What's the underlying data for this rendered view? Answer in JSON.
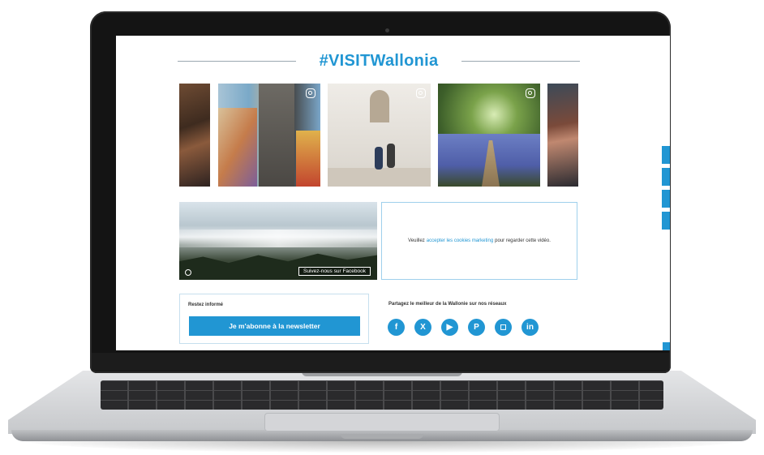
{
  "page": {
    "hashtag": "#VISITWallonia",
    "colors": {
      "accent": "#2196d3",
      "divider": "#9aa7b1",
      "border": "#9fd0ec"
    }
  },
  "instagram": {
    "tiles": [
      {
        "name": "street-art",
        "icon": "instagram-icon"
      },
      {
        "name": "mural-building",
        "icon": "instagram-icon"
      },
      {
        "name": "ceremony-hall",
        "icon": "instagram-icon"
      },
      {
        "name": "bluebell-forest",
        "icon": "instagram-icon"
      },
      {
        "name": "portrait-edge",
        "icon": "instagram-icon"
      }
    ]
  },
  "facebook_video": {
    "button_label": "Suivez-nous sur Facebook"
  },
  "cookie_notice": {
    "before": "Veuillez",
    "link": "accepter les cookies marketing",
    "after": "pour regarder cette vidéo."
  },
  "newsletter": {
    "label": "Restez informé",
    "button_label": "Je m'abonne à la newsletter"
  },
  "share": {
    "label": "Partagez le meilleur de la Wallonie sur nos réseaux",
    "networks": [
      {
        "name": "facebook",
        "glyph": "f"
      },
      {
        "name": "x",
        "glyph": "X"
      },
      {
        "name": "youtube",
        "glyph": "▶"
      },
      {
        "name": "pinterest",
        "glyph": "P"
      },
      {
        "name": "instagram",
        "glyph": "◻"
      },
      {
        "name": "linkedin",
        "glyph": "in"
      }
    ]
  }
}
